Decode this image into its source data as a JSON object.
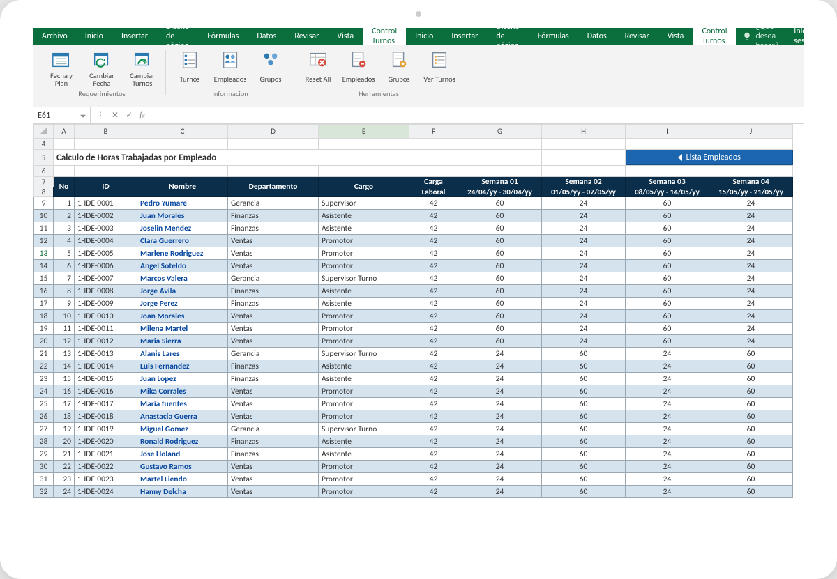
{
  "menubar": {
    "file": "Archivo",
    "tabs": [
      "Inicio",
      "Insertar",
      "Diseño de página",
      "Fórmulas",
      "Datos",
      "Revisar",
      "Vista",
      "Control Turnos"
    ],
    "active_tab": "Control Turnos",
    "tell_me": "¿Qué desea hacer?",
    "sign_in": "Iniciar sesi"
  },
  "ribbon": {
    "groups": [
      {
        "label": "Requerimientos",
        "buttons": [
          "Fecha y Plan",
          "Cambiar Fecha",
          "Cambiar Turnos"
        ]
      },
      {
        "label": "Informacion",
        "buttons": [
          "Turnos",
          "Empleados",
          "Grupos"
        ]
      },
      {
        "label": "Herramientas",
        "buttons": [
          "Reset All",
          "Empleados",
          "Grupos",
          "Ver Turnos"
        ]
      }
    ]
  },
  "namebox": "E61",
  "columns": [
    "A",
    "B",
    "C",
    "D",
    "E",
    "F",
    "G",
    "H",
    "I",
    "J"
  ],
  "selected_col": "E",
  "selected_row_header": 13,
  "visible_row_start": 4,
  "title": "Calculo de Horas Trabajadas por Empleado",
  "list_button": "Lista Empleados",
  "table_headers_top": [
    "No",
    "ID",
    "Nombre",
    "Departamento",
    "Cargo",
    "Carga",
    "Semana 01",
    "Semana 02",
    "Semana 03",
    "Semana 04"
  ],
  "table_headers_sub": [
    "",
    "",
    "",
    "",
    "",
    "Laboral",
    "24/04/yy - 30/04/yy",
    "01/05/yy - 07/05/yy",
    "08/05/yy - 14/05/yy",
    "15/05/yy - 21/05/yy"
  ],
  "rows": [
    {
      "row": 9,
      "no": 1,
      "id": "1-IDE-0001",
      "nombre": "Pedro Yumare",
      "dep": "Gerancia",
      "cargo": "Supervisor",
      "carga": 42,
      "s": [
        60,
        24,
        60,
        24
      ]
    },
    {
      "row": 10,
      "no": 2,
      "id": "1-IDE-0002",
      "nombre": "Juan Morales",
      "dep": "Finanzas",
      "cargo": "Asistente",
      "carga": 42,
      "s": [
        60,
        24,
        60,
        24
      ]
    },
    {
      "row": 11,
      "no": 3,
      "id": "1-IDE-0003",
      "nombre": "Joselin Mendez",
      "dep": "Finanzas",
      "cargo": "Asistente",
      "carga": 42,
      "s": [
        60,
        24,
        60,
        24
      ]
    },
    {
      "row": 12,
      "no": 4,
      "id": "1-IDE-0004",
      "nombre": "Clara Guerrero",
      "dep": "Ventas",
      "cargo": "Promotor",
      "carga": 42,
      "s": [
        60,
        24,
        60,
        24
      ]
    },
    {
      "row": 13,
      "no": 5,
      "id": "1-IDE-0005",
      "nombre": "Marlene Rodriguez",
      "dep": "Ventas",
      "cargo": "Promotor",
      "carga": 42,
      "s": [
        60,
        24,
        60,
        24
      ]
    },
    {
      "row": 14,
      "no": 6,
      "id": "1-IDE-0006",
      "nombre": "Angel Soteldo",
      "dep": "Ventas",
      "cargo": "Promotor",
      "carga": 42,
      "s": [
        60,
        24,
        60,
        24
      ]
    },
    {
      "row": 15,
      "no": 7,
      "id": "1-IDE-0007",
      "nombre": "Marcos Valera",
      "dep": "Gerancia",
      "cargo": "Supervisor Turno",
      "carga": 42,
      "s": [
        60,
        24,
        60,
        24
      ]
    },
    {
      "row": 16,
      "no": 8,
      "id": "1-IDE-0008",
      "nombre": "Jorge Avila",
      "dep": "Finanzas",
      "cargo": "Asistente",
      "carga": 42,
      "s": [
        60,
        24,
        60,
        24
      ]
    },
    {
      "row": 17,
      "no": 9,
      "id": "1-IDE-0009",
      "nombre": "Jorge Perez",
      "dep": "Finanzas",
      "cargo": "Asistente",
      "carga": 42,
      "s": [
        60,
        24,
        60,
        24
      ]
    },
    {
      "row": 18,
      "no": 10,
      "id": "1-IDE-0010",
      "nombre": "Joan Morales",
      "dep": "Ventas",
      "cargo": "Promotor",
      "carga": 42,
      "s": [
        60,
        24,
        60,
        24
      ]
    },
    {
      "row": 19,
      "no": 11,
      "id": "1-IDE-0011",
      "nombre": "Milena Martel",
      "dep": "Ventas",
      "cargo": "Promotor",
      "carga": 42,
      "s": [
        60,
        24,
        60,
        24
      ]
    },
    {
      "row": 20,
      "no": 12,
      "id": "1-IDE-0012",
      "nombre": "Maria Sierra",
      "dep": "Ventas",
      "cargo": "Promotor",
      "carga": 42,
      "s": [
        60,
        24,
        60,
        24
      ]
    },
    {
      "row": 21,
      "no": 13,
      "id": "1-IDE-0013",
      "nombre": "Alanis Lares",
      "dep": "Gerancia",
      "cargo": "Supervisor Turno",
      "carga": 42,
      "s": [
        24,
        60,
        24,
        60
      ]
    },
    {
      "row": 22,
      "no": 14,
      "id": "1-IDE-0014",
      "nombre": "Luis Fernandez",
      "dep": "Finanzas",
      "cargo": "Asistente",
      "carga": 42,
      "s": [
        24,
        60,
        24,
        60
      ]
    },
    {
      "row": 23,
      "no": 15,
      "id": "1-IDE-0015",
      "nombre": "Juan Lopez",
      "dep": "Finanzas",
      "cargo": "Asistente",
      "carga": 42,
      "s": [
        24,
        60,
        24,
        60
      ]
    },
    {
      "row": 24,
      "no": 16,
      "id": "1-IDE-0016",
      "nombre": "Mika Corrales",
      "dep": "Ventas",
      "cargo": "Promotor",
      "carga": 42,
      "s": [
        24,
        60,
        24,
        60
      ]
    },
    {
      "row": 25,
      "no": 17,
      "id": "1-IDE-0017",
      "nombre": "Maria fuentes",
      "dep": "Ventas",
      "cargo": "Promotor",
      "carga": 42,
      "s": [
        24,
        60,
        24,
        60
      ]
    },
    {
      "row": 26,
      "no": 18,
      "id": "1-IDE-0018",
      "nombre": "Anastacia Guerra",
      "dep": "Ventas",
      "cargo": "Promotor",
      "carga": 42,
      "s": [
        24,
        60,
        24,
        60
      ]
    },
    {
      "row": 27,
      "no": 19,
      "id": "1-IDE-0019",
      "nombre": "Miguel Gomez",
      "dep": "Gerancia",
      "cargo": "Supervisor Turno",
      "carga": 42,
      "s": [
        24,
        60,
        24,
        60
      ]
    },
    {
      "row": 28,
      "no": 20,
      "id": "1-IDE-0020",
      "nombre": "Ronald Rodriguez",
      "dep": "Finanzas",
      "cargo": "Asistente",
      "carga": 42,
      "s": [
        24,
        60,
        24,
        60
      ]
    },
    {
      "row": 29,
      "no": 21,
      "id": "1-IDE-0021",
      "nombre": "Jose Holand",
      "dep": "Finanzas",
      "cargo": "Asistente",
      "carga": 42,
      "s": [
        24,
        60,
        24,
        60
      ]
    },
    {
      "row": 30,
      "no": 22,
      "id": "1-IDE-0022",
      "nombre": "Gustavo Ramos",
      "dep": "Ventas",
      "cargo": "Promotor",
      "carga": 42,
      "s": [
        24,
        60,
        24,
        60
      ]
    },
    {
      "row": 31,
      "no": 23,
      "id": "1-IDE-0023",
      "nombre": "Martel Liendo",
      "dep": "Ventas",
      "cargo": "Promotor",
      "carga": 42,
      "s": [
        24,
        60,
        24,
        60
      ]
    },
    {
      "row": 32,
      "no": 24,
      "id": "1-IDE-0024",
      "nombre": "Hanny Delcha",
      "dep": "Ventas",
      "cargo": "Promotor",
      "carga": 42,
      "s": [
        24,
        60,
        24,
        60
      ]
    }
  ]
}
